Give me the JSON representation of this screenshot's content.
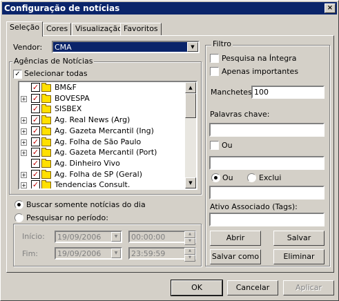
{
  "window": {
    "title": "Configuração de notícias",
    "close": "×"
  },
  "tabs": [
    "Seleção",
    "Cores",
    "Visualização",
    "Favoritos"
  ],
  "vendor": {
    "label": "Vendor:",
    "value": "CMA"
  },
  "agencies": {
    "group_label": "Agências de Notícias",
    "select_all": "Selecionar todas",
    "items": [
      {
        "label": "BM&F",
        "expand": false
      },
      {
        "label": "BOVESPA",
        "expand": true
      },
      {
        "label": "SISBEX",
        "expand": false
      },
      {
        "label": "Ag. Real News (Arg)",
        "expand": true
      },
      {
        "label": "Ag. Gazeta Mercantil (Ing)",
        "expand": true
      },
      {
        "label": "Ag. Folha de São Paulo",
        "expand": true
      },
      {
        "label": "Ag. Gazeta Mercantil (Port)",
        "expand": true
      },
      {
        "label": "Ag. Dinheiro Vivo",
        "expand": false
      },
      {
        "label": "Ag. Folha de SP (Geral)",
        "expand": true
      },
      {
        "label": "Tendencias Consult.",
        "expand": true
      }
    ]
  },
  "period": {
    "today_label": "Buscar somente notícias do dia",
    "range_label": "Pesquisar no período:",
    "start_label": "Início:",
    "end_label": "Fim:",
    "start_date": "19/09/2006",
    "start_time": "00:00:00",
    "end_date": "19/09/2006",
    "end_time": "23:59:59"
  },
  "filter": {
    "group_label": "Filtro",
    "full_search": "Pesquisa na Íntegra",
    "important_only": "Apenas importantes",
    "headlines_label": "Manchetes",
    "headlines_value": "100",
    "keywords_label": "Palavras chave:",
    "or_label": "Ou",
    "or2_label": "Ou",
    "exclude_label": "Exclui",
    "asset_label": "Ativo Associado (Tags):"
  },
  "buttons": {
    "open": "Abrir",
    "save": "Salvar",
    "save_as": "Salvar como",
    "delete": "Eliminar",
    "ok": "OK",
    "cancel": "Cancelar",
    "apply": "Aplicar"
  }
}
